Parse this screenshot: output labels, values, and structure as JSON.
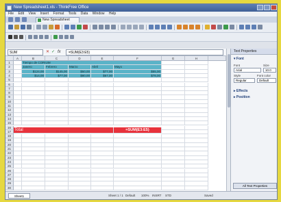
{
  "window": {
    "title": "New Spreadsheet1.xls - ThinkFree Office"
  },
  "menu": [
    "File",
    "Edit",
    "View",
    "Insert",
    "Format",
    "Tools",
    "Data",
    "Window",
    "Help"
  ],
  "tab": {
    "label": "New Spreadsheet"
  },
  "formula_bar": {
    "name_box": "SUM",
    "cancel": "✕",
    "accept": "✓",
    "fx": "fx",
    "formula": "=SUM(E3:E5)"
  },
  "columns": [
    "A",
    "B",
    "C",
    "D",
    "E",
    "F",
    "G",
    "H"
  ],
  "rows": [
    "1",
    "2",
    "3",
    "4",
    "5",
    "6",
    "7",
    "8",
    "9",
    "10",
    "11",
    "12",
    "13",
    "14",
    "15",
    "16",
    "17",
    "18",
    "19",
    "20",
    "21",
    "22",
    "23",
    "24",
    "25",
    "26",
    "27",
    "28",
    "29",
    "30"
  ],
  "table": {
    "title": "Tiempo de CORIUM",
    "headers": [
      "Janero",
      "Febrero",
      "Marzo",
      "Abril",
      "Mayo"
    ],
    "row1": [
      "$124,00",
      "$145,00",
      "$50,00",
      "$77,00",
      "$55,00"
    ],
    "row2": [
      "$14,00",
      "$77,00",
      "$80,00",
      "$67,00",
      "$78,00"
    ]
  },
  "total": {
    "label": "Total",
    "formula": "=SUM(E3:E5)"
  },
  "panel": {
    "title": "Text Properties",
    "font_section": "Font",
    "font_label": "Font",
    "size_label": "Size",
    "font_value": "Arial",
    "size_value": "10.0",
    "style_label": "Style",
    "color_label": "Font color",
    "style_value": "Regular",
    "color_value": "Default",
    "effects_section": "Effects",
    "position_section": "Position",
    "all_button": "All Text Properties"
  },
  "status": {
    "sheet_tab": "Sheet1",
    "sheet_count": "Sheet 1 / 1",
    "mode": "Default",
    "zoom": "100%",
    "insert": "INSRT",
    "std": "STD",
    "saved": "Saved"
  },
  "colors": {
    "accent_teal": "#5ab3c8",
    "total_red": "#e8323c",
    "background_yellow": "#e6d840"
  }
}
